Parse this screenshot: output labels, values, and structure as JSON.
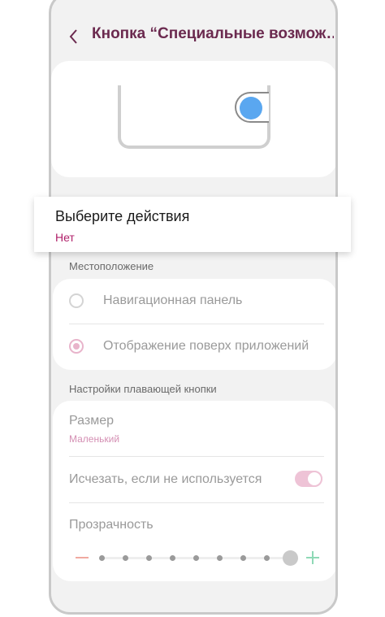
{
  "header": {
    "title": "Кнопка “Специальные возмож…"
  },
  "actions": {
    "title": "Выберите действия",
    "value": "Нет"
  },
  "location": {
    "section_label": "Местоположение",
    "options": [
      {
        "label": "Навигационная панель",
        "selected": false
      },
      {
        "label": "Отображение поверх приложений",
        "selected": true
      }
    ]
  },
  "floating": {
    "section_label": "Настройки плавающей кнопки",
    "size_title": "Размер",
    "size_value": "Маленький",
    "hide_label": "Исчезать, если не используется",
    "hide_enabled": true,
    "transparency_label": "Прозрачность",
    "transparency_level": 8,
    "transparency_steps": 8
  },
  "colors": {
    "accent": "#6b2a4f",
    "value_pink": "#b0206a",
    "toggle_pink": "#eec3d6",
    "float_blue": "#5aa7f0"
  }
}
